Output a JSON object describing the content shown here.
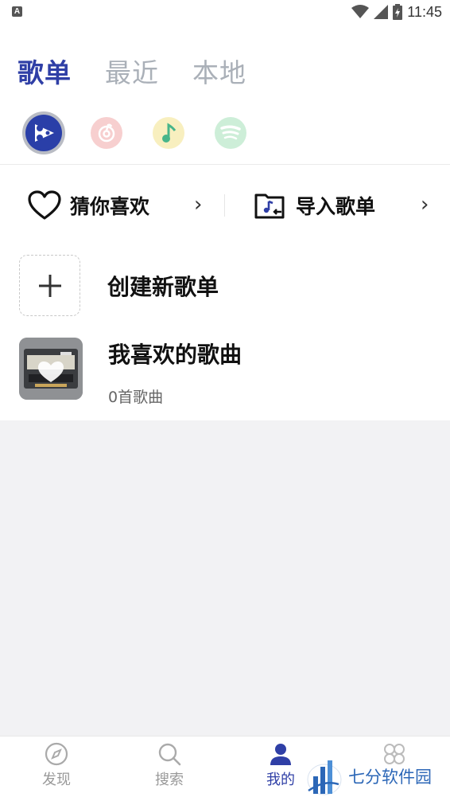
{
  "status_bar": {
    "app_badge": "A",
    "time": "11:45"
  },
  "tabs": [
    {
      "label": "歌单",
      "active": true
    },
    {
      "label": "最近",
      "active": false
    },
    {
      "label": "本地",
      "active": false
    }
  ],
  "sources": [
    {
      "name": "app-source",
      "color": "#2a3fa8",
      "active": true
    },
    {
      "name": "netease-source",
      "color": "#f3c6c6",
      "active": false
    },
    {
      "name": "qq-music-source",
      "color": "#f8ecb8",
      "active": false
    },
    {
      "name": "spotify-source",
      "color": "#c9efd6",
      "active": false
    }
  ],
  "quick_actions": {
    "guess": {
      "label": "猜你喜欢",
      "icon": "heart-outline-icon"
    },
    "import": {
      "label": "导入歌单",
      "icon": "import-folder-icon"
    }
  },
  "playlists": {
    "create_label": "创建新歌单",
    "liked": {
      "title": "我喜欢的歌曲",
      "count": "0首歌曲"
    }
  },
  "bottom_nav": [
    {
      "label": "发现",
      "icon": "compass-icon",
      "active": false
    },
    {
      "label": "搜索",
      "icon": "search-icon",
      "active": false
    },
    {
      "label": "我的",
      "icon": "person-icon",
      "active": true
    },
    {
      "label": "",
      "icon": "apps-icon",
      "active": false
    }
  ],
  "watermark": {
    "text": "七分软件园"
  },
  "colors": {
    "accent": "#2f3fa6",
    "inactive_tab": "#aab0b8",
    "background": "#f2f2f4"
  }
}
